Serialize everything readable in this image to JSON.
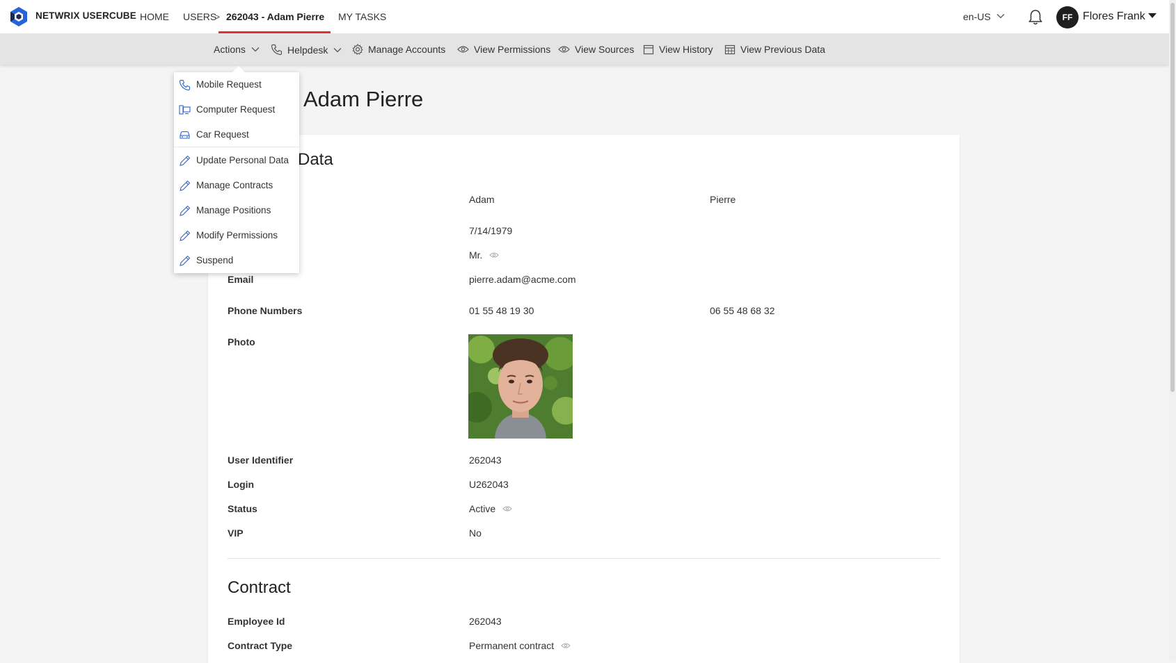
{
  "header": {
    "brand": "NETWRIX USERCUBE",
    "nav": {
      "home": "HOME",
      "users": "USERS",
      "separator": ">",
      "current": "262043 - Adam Pierre",
      "tasks": "MY TASKS"
    },
    "language": "en-US",
    "user": {
      "initials": "FF",
      "name": "Flores Frank"
    },
    "colors": {
      "accent": "#e03131",
      "logo_blue": "#2764d8",
      "logo_dark": "#1c2a4d"
    }
  },
  "actionbar": {
    "actions": "Actions",
    "helpdesk": "Helpdesk",
    "manage_accounts": "Manage Accounts",
    "view_permissions": "View Permissions",
    "view_sources": "View Sources",
    "view_history": "View History",
    "view_previous_data": "View Previous Data"
  },
  "menu": {
    "items": [
      {
        "label": "Mobile Request",
        "icon": "phone-icon"
      },
      {
        "label": "Computer Request",
        "icon": "computer-icon"
      },
      {
        "label": "Car Request",
        "icon": "car-icon"
      },
      {
        "label": "Update Personal Data",
        "icon": "pencil-icon"
      },
      {
        "label": "Manage Contracts",
        "icon": "pencil-icon"
      },
      {
        "label": "Manage Positions",
        "icon": "pencil-icon"
      },
      {
        "label": "Modify Permissions",
        "icon": "pencil-icon"
      },
      {
        "label": "Suspend",
        "icon": "pencil-icon"
      }
    ]
  },
  "page": {
    "title": "Adam Pierre",
    "personal_section_title": "Data",
    "fields": {
      "first_name": "Adam",
      "last_name": "Pierre",
      "birth_date": "7/14/1979",
      "title": "Mr.",
      "email_label": "Email",
      "email": "pierre.adam@acme.com",
      "phone_label": "Phone Numbers",
      "phone1": "01 55 48 19 30",
      "phone2": "06 55 48 68 32",
      "photo_label": "Photo",
      "user_id_label": "User Identifier",
      "user_id": "262043",
      "login_label": "Login",
      "login": "U262043",
      "status_label": "Status",
      "status": "Active",
      "vip_label": "VIP",
      "vip": "No"
    },
    "contract_section_title": "Contract",
    "contract": {
      "employee_id_label": "Employee Id",
      "employee_id": "262043",
      "contract_type_label": "Contract Type",
      "contract_type": "Permanent contract"
    }
  }
}
